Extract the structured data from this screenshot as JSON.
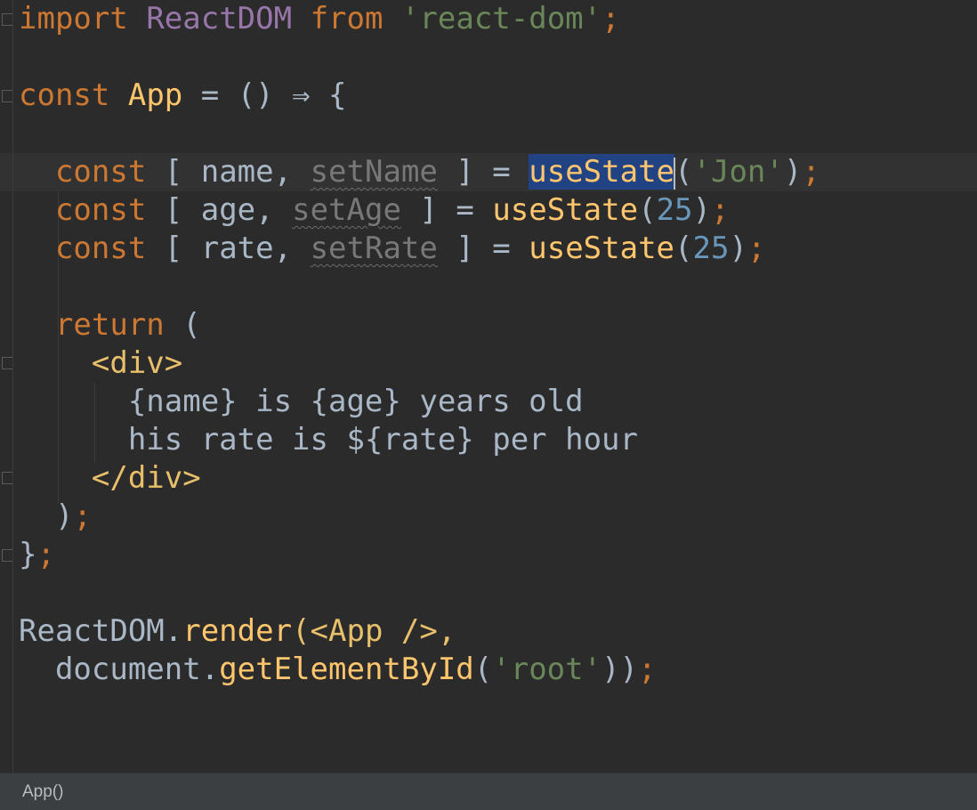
{
  "editor": {
    "lines": {
      "l1": {
        "import_kw": "import",
        "react_dom": "ReactDOM",
        "from_kw": "from",
        "module_str": "'react-dom'",
        "semi": ";"
      },
      "l3": {
        "const_kw": "const",
        "app_name": "App",
        "arrow": "= () ⇒ {"
      },
      "l5": {
        "const_kw": "const",
        "open": "[ name,",
        "setter": "setName",
        "close": "] =",
        "hook_selected": "useState",
        "paren_open": "(",
        "arg": "'Jon'",
        "paren_close": ")",
        "semi": ";"
      },
      "l6": {
        "const_kw": "const",
        "open": "[ age,",
        "setter": "setAge",
        "close": "] =",
        "hook": "useState",
        "paren_open": "(",
        "arg": "25",
        "paren_close": ")",
        "semi": ";"
      },
      "l7": {
        "const_kw": "const",
        "open": "[ rate,",
        "setter": "setRate",
        "close": "] =",
        "hook": "useState",
        "paren_open": "(",
        "arg": "25",
        "paren_close": ")",
        "semi": ";"
      },
      "l9": {
        "return_kw": "return",
        "paren": "("
      },
      "l10": {
        "open_tag": "<div>"
      },
      "l11": {
        "text": "{name} is {age} years old"
      },
      "l12": {
        "text": "his rate is ${rate} per hour"
      },
      "l13": {
        "close_tag": "</div>"
      },
      "l14": {
        "paren": ")",
        "semi": ";"
      },
      "l15": {
        "brace": "}",
        "semi": ";"
      },
      "l17": {
        "obj": "ReactDOM.",
        "method": "render",
        "args": "(<App />,",
        "comma": ""
      },
      "l18": {
        "obj": "document.",
        "method": "getElementById",
        "paren_open": "(",
        "arg": "'root'",
        "paren_close": "))",
        "semi": ";"
      }
    }
  },
  "statusbar": {
    "breadcrumb": "App()"
  },
  "colors": {
    "background": "#2b2b2b",
    "keyword": "#cc7832",
    "class_name": "#9876aa",
    "string": "#6a8759",
    "function": "#ffc66d",
    "number": "#6897bb",
    "selection": "#214283"
  }
}
